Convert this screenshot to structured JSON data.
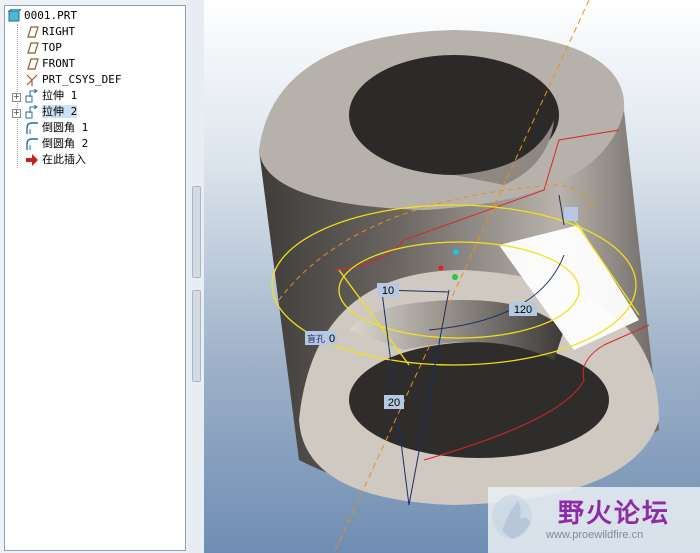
{
  "model_tree": {
    "root": "0001.PRT",
    "items": [
      {
        "label": "RIGHT",
        "icon": "datum-plane-icon"
      },
      {
        "label": "TOP",
        "icon": "datum-plane-icon"
      },
      {
        "label": "FRONT",
        "icon": "datum-plane-icon"
      },
      {
        "label": "PRT_CSYS_DEF",
        "icon": "csys-icon"
      },
      {
        "label": "拉伸 1",
        "icon": "extrude-icon"
      },
      {
        "label": "拉伸 2",
        "icon": "extrude-icon"
      },
      {
        "label": "倒圆角 1",
        "icon": "round-icon"
      },
      {
        "label": "倒圆角 2",
        "icon": "round-icon"
      },
      {
        "label": "在此插入",
        "icon": "insert-here-arrow-icon"
      }
    ]
  },
  "dimensions": {
    "d10": "10",
    "d20": "20",
    "d120": "120",
    "d0": "0",
    "depth_tag": "盲孔"
  },
  "watermark": {
    "title": "野火论坛",
    "url": "www.proewildfire.cn"
  }
}
